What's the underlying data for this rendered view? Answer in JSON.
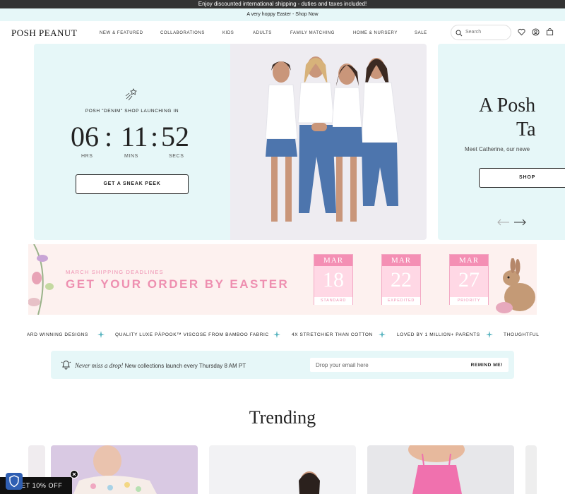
{
  "topbar": {
    "text": "Enjoy discounted international shipping - duties and taxes included!"
  },
  "promo": {
    "text": "A very hoppy Easter - Shop Now"
  },
  "header": {
    "logo": "POSH PEANUT",
    "nav": [
      "NEW & FEATURED",
      "COLLABORATIONS",
      "KIDS",
      "ADULTS",
      "FAMILY MATCHING",
      "HOME & NURSERY",
      "SALE"
    ],
    "search_placeholder": "Search",
    "icons": [
      "search-icon",
      "heart-icon",
      "account-icon",
      "bag-icon"
    ]
  },
  "hero": {
    "launch_text": "POSH \"DENIM\" SHOP LAUNCHING IN",
    "countdown": {
      "hrs": "06",
      "mins": "11",
      "secs": "52",
      "sep": ":"
    },
    "labels": {
      "hrs": "HRS",
      "mins": "MINS",
      "secs": "SECS"
    },
    "cta": "GET A SNEAK PEEK"
  },
  "hero2": {
    "title_line1": "A Posh",
    "title_line2": "Ta",
    "subtitle": "Meet Catherine, our newe",
    "cta": "SHOP"
  },
  "easter": {
    "small": "MARCH SHIPPING DEADLINES",
    "big": "GET YOUR ORDER BY EASTER",
    "dates": [
      {
        "month": "MAR",
        "day": "18",
        "kind": "STANDARD"
      },
      {
        "month": "MAR",
        "day": "22",
        "kind": "EXPEDITED"
      },
      {
        "month": "MAR",
        "day": "27",
        "kind": "PRIORITY"
      }
    ]
  },
  "ticker": [
    "ARD WINNING DESIGNS",
    "QUALITY LUXE PĀPOOK™ VISCOSE FROM BAMBOO FABRIC",
    "4X STRETCHIER THAN COTTON",
    "LOVED BY 1 MILLION+ PARENTS",
    "THOUGHTFUL"
  ],
  "notify": {
    "bold": "Never miss a drop!",
    "text": " New collections launch every Thursday 8 AM PT",
    "placeholder": "Drop your email here",
    "button": "REMIND ME!"
  },
  "trending": {
    "title": "Trending"
  },
  "discount": {
    "text": "ET 10% OFF"
  },
  "colors": {
    "mint": "#e6f7f8",
    "pink": "#ee8fb0",
    "dark": "#222222"
  }
}
